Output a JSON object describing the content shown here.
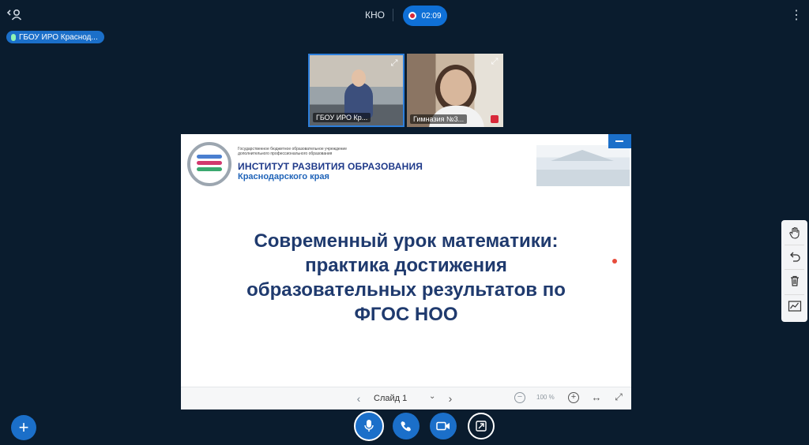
{
  "header": {
    "session_name": "КНО",
    "recording_time": "02:09"
  },
  "presenter": {
    "name": "ГБОУ ИРО Краснод..."
  },
  "videos": [
    {
      "name": "ГБОУ ИРО Кр..."
    },
    {
      "name": "Гимназия №3..."
    }
  ],
  "slide": {
    "institution_small_1": "Государственное бюджетное образовательное учреждение",
    "institution_small_2": "дополнительного профессионального образования",
    "institution_name": "ИНСТИТУТ РАЗВИТИЯ ОБРАЗОВАНИЯ",
    "institution_region": "Краснодарского края",
    "title_line_1": "Современный урок математики:",
    "title_line_2": "практика достижения",
    "title_line_3": "образовательных результатов по",
    "title_line_4": "ФГОС НОО"
  },
  "slide_toolbar": {
    "current_slide": "Слайд 1",
    "zoom_level": "100 %"
  },
  "icons": {
    "users": "users-icon",
    "menu": "kebab-menu-icon",
    "hand": "hand-icon",
    "undo": "undo-icon",
    "trash": "trash-icon",
    "chart": "chart-icon"
  },
  "colors": {
    "background": "#0a1c2e",
    "accent": "#1b6fc9",
    "recording": "#d8293a",
    "slide_title": "#1f3a6e"
  }
}
